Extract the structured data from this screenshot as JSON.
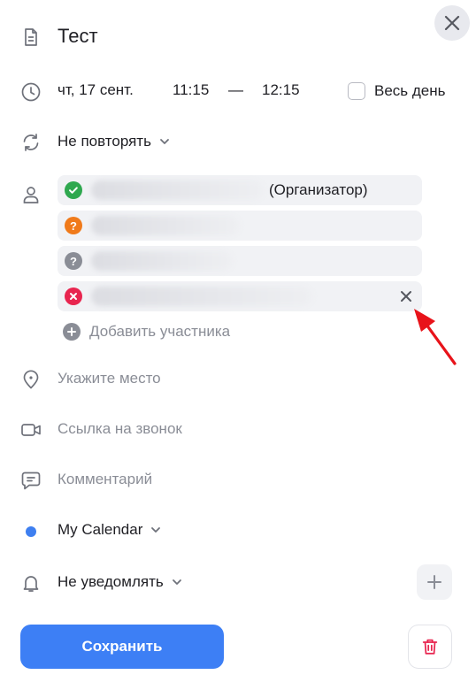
{
  "event": {
    "title": "Тест"
  },
  "datetime": {
    "date": "чт, 17 сент.",
    "start_time": "11:15",
    "separator": "—",
    "end_time": "12:15",
    "all_day_label": "Весь день",
    "all_day_checked": false
  },
  "repeat": {
    "label": "Не повторять"
  },
  "participants": [
    {
      "status": "accepted",
      "role_label": "(Организатор)"
    },
    {
      "status": "tentative",
      "role_label": ""
    },
    {
      "status": "unknown",
      "role_label": ""
    },
    {
      "status": "declined",
      "role_label": ""
    }
  ],
  "add_participant_label": "Добавить участника",
  "location": {
    "placeholder": "Укажите место"
  },
  "call_link": {
    "placeholder": "Ссылка на звонок"
  },
  "comment": {
    "placeholder": "Комментарий"
  },
  "calendar": {
    "label": "My Calendar",
    "color": "#3e7ff0"
  },
  "notification": {
    "label": "Не уведомлять"
  },
  "actions": {
    "save_label": "Сохранить"
  },
  "colors": {
    "accent": "#3d7ff5",
    "accepted": "#2fa84f",
    "tentative": "#f07a1a",
    "unknown": "#8a8d96",
    "declined": "#e8254f",
    "delete": "#e8254f",
    "annotation_arrow": "#e8131a"
  }
}
